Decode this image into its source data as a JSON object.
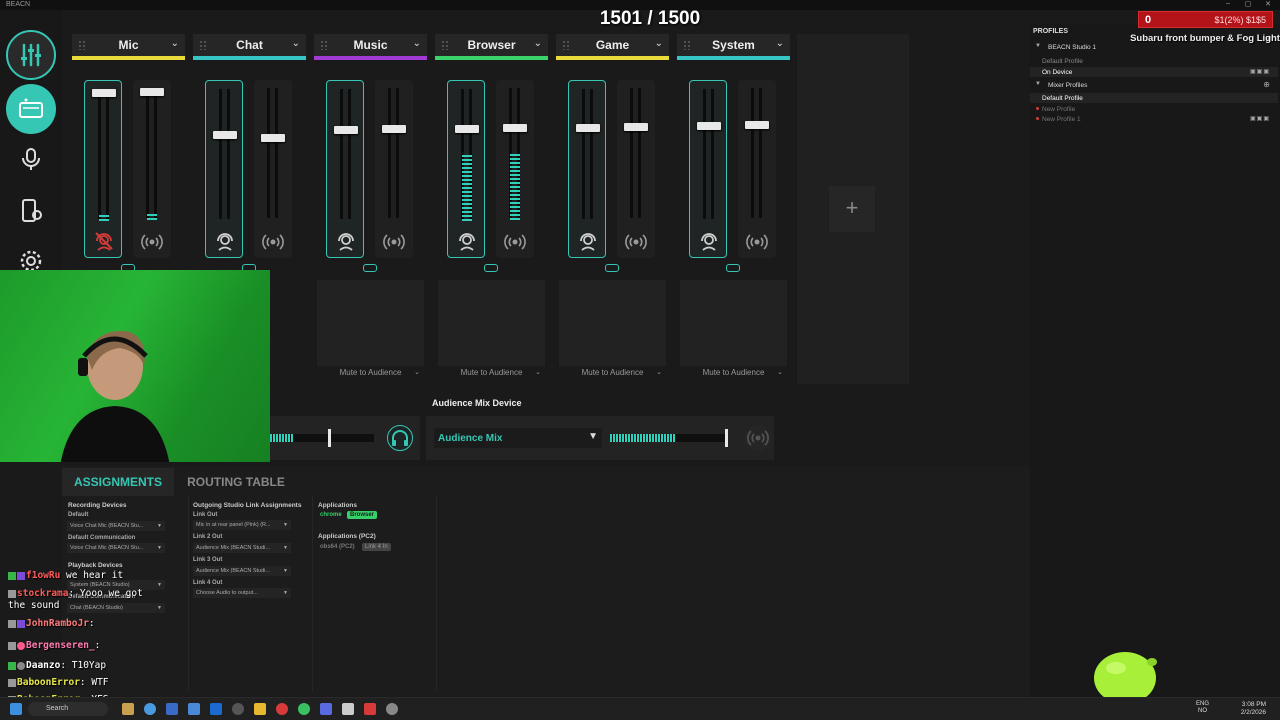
{
  "window": {
    "title": "BEACN",
    "controls": [
      "–",
      "▢",
      "✕"
    ]
  },
  "counter": "1501 / 1500",
  "nav": {
    "items": [
      {
        "name": "mixer",
        "icon": "sliders-icon"
      },
      {
        "name": "devices",
        "icon": "audio-device-icon"
      },
      {
        "name": "mic",
        "icon": "microphone-icon"
      },
      {
        "name": "app-routing",
        "icon": "phone-settings-icon"
      },
      {
        "name": "settings",
        "icon": "gear-icon"
      }
    ]
  },
  "channels": [
    {
      "name": "Mic",
      "color": "#e8db3a",
      "mute": ""
    },
    {
      "name": "Chat",
      "color": "#36c6c6",
      "mute": ""
    },
    {
      "name": "Music",
      "color": "#a23ad6",
      "mute": "Mute to Audience"
    },
    {
      "name": "Browser",
      "color": "#3ad46b",
      "mute": "Mute to Audience"
    },
    {
      "name": "Game",
      "color": "#e8db3a",
      "mute": "Mute to Audience"
    },
    {
      "name": "System",
      "color": "#36c6c6",
      "mute": "Mute to Audience"
    }
  ],
  "add_channel": "+",
  "audience": {
    "title": "Audience Mix Device",
    "device": "Audience Mix",
    "level": 0.55
  },
  "profiles": {
    "title": "PROFILES",
    "device_name": "BEACN Studio 1",
    "default_profile": "Default Profile",
    "on_device": "On Device",
    "mixer_profiles": "Mixer Profiles",
    "mixer_default": "Default Profile",
    "new_profile": "New Profile",
    "new_profile_1": "New Profile 1"
  },
  "overlay": {
    "red_value": "0",
    "red_text": "$1(2%)  $1$5",
    "note": "Subaru front bumper & Fog Light"
  },
  "tabs": {
    "assignments": "ASSIGNMENTS",
    "routing": "ROUTING TABLE"
  },
  "assignments": {
    "recording_devices": "Recording Devices",
    "default": "Default",
    "default_value": "Voice Chat Mic (BEACN Stu...",
    "default_comm": "Default Communication",
    "default_comm_value": "Voice Chat Mic (BEACN Stu...",
    "playback_devices": "Playback Devices",
    "playback_default_value": "System (BEACN Studio)",
    "playback_comm": "Default Communication",
    "playback_comm_value": "Chat (BEACN Studio)",
    "outgoing_title": "Outgoing Studio Link Assignments",
    "link_out": "Link Out",
    "link_out_value": "Mic in at rear panel (Pink) (R...",
    "link2": "Link 2 Out",
    "link2_value": "Audience Mix (BEACN Studi...",
    "link3": "Link 3 Out",
    "link3_value": "Audience Mix (BEACN Studi...",
    "link4": "Link 4 Out",
    "link4_value": "Choose Audio to output...",
    "applications": "Applications",
    "app1": "chrome",
    "app1_chip": "Browser",
    "applications_pc2": "Applications (PC2)",
    "app2": "obs64 (PC2)",
    "app2_chip": "Link 4 In"
  },
  "chat": [
    {
      "user": "f1owRu",
      "color": "#ff5a5a",
      "msg": " we hear it"
    },
    {
      "user": "stockrama",
      "color": "#ff5a5a",
      "msg": ": Yooo we got"
    },
    {
      "user": "",
      "color": "#ffffff",
      "msg": "the sound"
    },
    {
      "user": "JohnRamboJr",
      "color": "#ff7a7a",
      "msg": ":"
    },
    {
      "user": "Bergenseren_",
      "color": "#ff7ab0",
      "msg": ":"
    },
    {
      "user": "Daanzo",
      "color": "#ffffff",
      "msg": ": T10Yap"
    },
    {
      "user": "BaboonError",
      "color": "#e8e84a",
      "msg": ": WTF"
    },
    {
      "user": "BaboonError",
      "color": "#e8e84a",
      "msg": ": YES"
    }
  ],
  "taskbar": {
    "search": "Search",
    "lang1": "ENG",
    "lang2": "NO",
    "time": "3:08 PM",
    "date": "2/2/2026"
  }
}
